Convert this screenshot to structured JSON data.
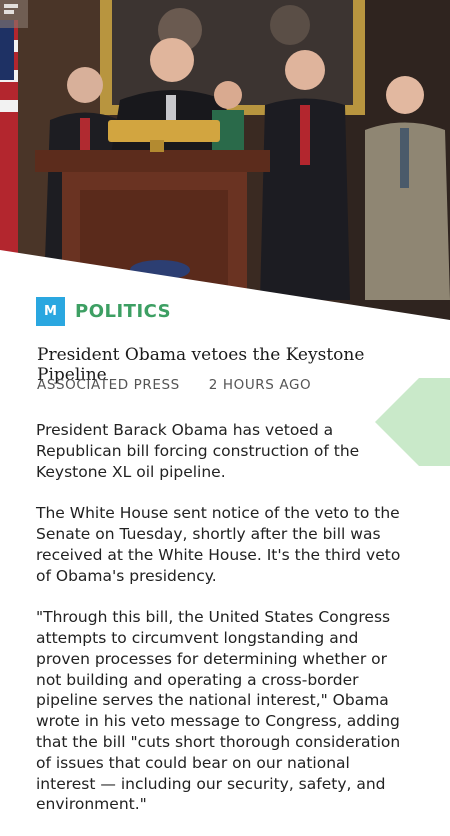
{
  "article": {
    "section": "POLITICS",
    "logo_letter": "M",
    "headline": "President Obama vetoes the Keystone Pipeline",
    "source": "ASSOCIATED PRESS",
    "time_ago": "2 HOURS AGO",
    "paragraphs": [
      "President Barack Obama has vetoed a Republican bill forcing construction of the Keystone XL oil pipeline.",
      "The White House sent notice of the veto to the Senate on Tuesday, shortly after the bill was received at the White House. It's the third veto of Obama's presidency.",
      "\"Through this bill, the United States Congress attempts to circumvent longstanding and proven processes for determining whether or not building and operating a cross-border pipeline serves the national interest,\" Obama wrote in his veto message to Congress, adding that the bill \"cuts short thorough consideration of issues that could bear on our national interest — including our security, safety, and environment.\""
    ]
  },
  "colors": {
    "section": "#3d9f63",
    "logo": "#2aa7e0",
    "next_arrow": "#c9e9c9"
  },
  "icons": {
    "top_left": "panel-icon",
    "next": "next-arrow-icon"
  }
}
